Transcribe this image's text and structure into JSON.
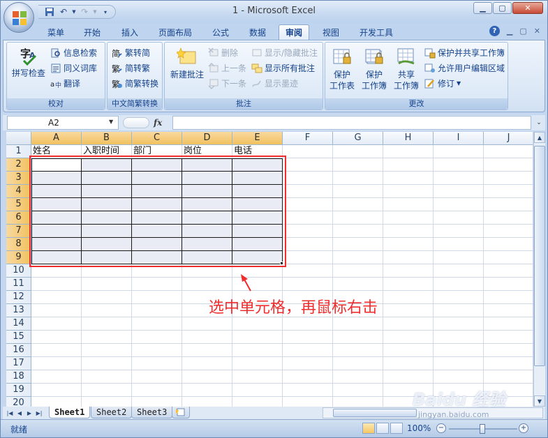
{
  "window": {
    "title": "1 - Microsoft Excel"
  },
  "ribbon_tabs": [
    "菜单",
    "开始",
    "插入",
    "页面布局",
    "公式",
    "数据",
    "审阅",
    "视图",
    "开发工具"
  ],
  "active_tab": "审阅",
  "groups": {
    "proofing": {
      "label": "校对",
      "spelling": "拼写检查",
      "research": "信息检索",
      "thesaurus": "同义词库",
      "translate": "翻译"
    },
    "chinese": {
      "label": "中文简繁转换",
      "to_simplified": "繁转简",
      "to_traditional": "简转繁",
      "convert": "简繁转换"
    },
    "comments": {
      "label": "批注",
      "new": "新建批注",
      "delete": "删除",
      "previous": "上一条",
      "next": "下一条",
      "show_hide": "显示/隐藏批注",
      "show_all": "显示所有批注",
      "show_ink": "显示墨迹"
    },
    "changes": {
      "label": "更改",
      "protect_sheet_1": "保护",
      "protect_sheet_2": "工作表",
      "protect_wb_1": "保护",
      "protect_wb_2": "工作簿",
      "share_wb_1": "共享",
      "share_wb_2": "工作簿",
      "protect_share": "保护并共享工作簿",
      "allow_edit": "允许用户编辑区域",
      "track": "修订"
    }
  },
  "formula_bar": {
    "name_box": "A2",
    "fx": "fx",
    "formula": ""
  },
  "columns": [
    "A",
    "B",
    "C",
    "D",
    "E",
    "F",
    "G",
    "H",
    "I",
    "J"
  ],
  "rows": [
    "1",
    "2",
    "3",
    "4",
    "5",
    "6",
    "7",
    "8",
    "9",
    "10",
    "11",
    "12",
    "13",
    "14",
    "15",
    "16",
    "17",
    "18",
    "19",
    "20"
  ],
  "header_row": [
    "姓名",
    "入职时间",
    "部门",
    "岗位",
    "电话"
  ],
  "annotation": "选中单元格，再鼠标右击",
  "sheets": [
    "Sheet1",
    "Sheet2",
    "Sheet3"
  ],
  "active_sheet": "Sheet1",
  "status": {
    "text": "就绪",
    "zoom": "100%"
  },
  "watermark": {
    "brand": "Baidu 经验",
    "url": "jingyan.baidu.com"
  },
  "colors": {
    "selection": "#e9ebf5",
    "annotation": "#f02d2d",
    "header_selected": "#f1c15f"
  }
}
